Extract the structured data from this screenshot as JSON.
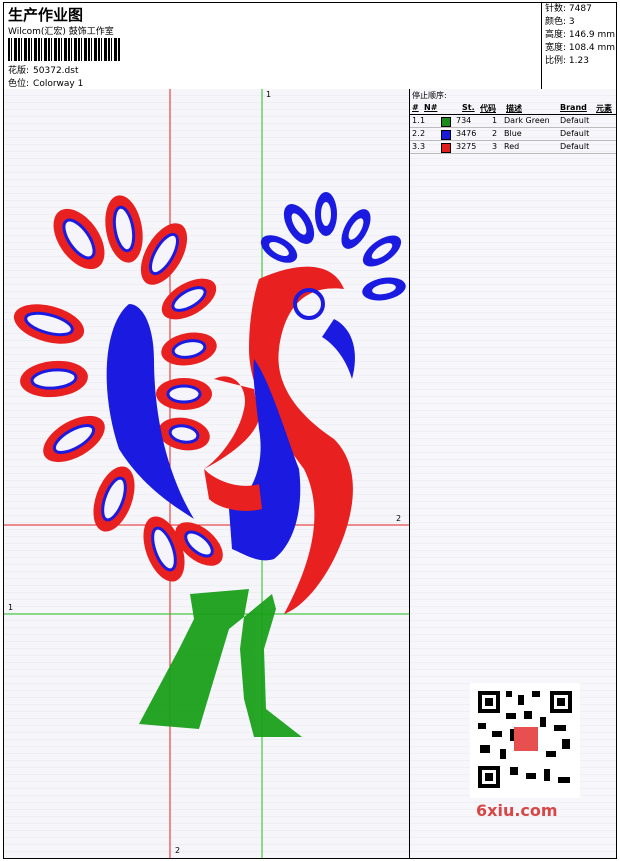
{
  "header": {
    "title": "生产作业图",
    "subtitle": "Wilcom(汇宏) 鼓饰工作室",
    "design_label": "花版:",
    "design_value": "50372.dst",
    "colorway_label": "色位:",
    "colorway_value": "Colorway 1"
  },
  "stats": {
    "stitches": "针数: 7487",
    "colors": "颜色: 3",
    "height": "高度: 146.9 mm",
    "width": "宽度: 108.4 mm",
    "scale": "比例: 1.23"
  },
  "guides": {
    "v1": "1",
    "v2": "2",
    "h1": "1",
    "h2": "2"
  },
  "stop_panel": {
    "title": "停止顺序:",
    "headers": [
      "#",
      "N#",
      "St.",
      "代码",
      "描述",
      "Brand",
      "元素"
    ],
    "rows": [
      {
        "idx": "1.",
        "n": "1",
        "color": "#1a8c1a",
        "st": "734",
        "code": "1",
        "desc": "Dark Green",
        "brand": "Default"
      },
      {
        "idx": "2.",
        "n": "2",
        "color": "#1a1ad9",
        "st": "3476",
        "code": "2",
        "desc": "Blue",
        "brand": "Default"
      },
      {
        "idx": "3.",
        "n": "3",
        "color": "#e01e1e",
        "st": "3275",
        "code": "3",
        "desc": "Red",
        "brand": "Default"
      }
    ]
  },
  "watermark": "6xiu.com",
  "colors": {
    "green": "#1aa01a",
    "blue": "#1a1ae0",
    "red": "#e82020",
    "guide_red": "#e02020",
    "guide_green": "#20c020"
  }
}
